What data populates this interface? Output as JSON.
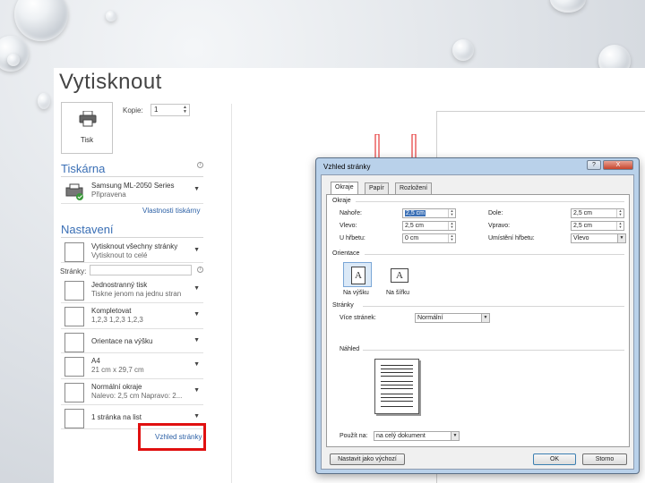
{
  "backstage": {
    "title": "Vytisknout",
    "print_button_label": "Tisk",
    "copies_label": "Kopie:",
    "copies_value": "1",
    "printer_section": "Tiskárna",
    "printer_name": "Samsung ML-2050 Series",
    "printer_status": "Připravena",
    "printer_properties_link": "Vlastnosti tiskárny",
    "settings_section": "Nastavení",
    "pages_label": "Stránky:",
    "settings": [
      {
        "line1": "Vytisknout všechny stránky",
        "line2": "Vytisknout to celé"
      },
      {
        "line1": "Jednostranný tisk",
        "line2": "Tiskne jenom na jednu stran"
      },
      {
        "line1": "Kompletovat",
        "line2": "1,2,3   1,2,3   1,2,3"
      },
      {
        "line1": "Orientace na výšku",
        "line2": ""
      },
      {
        "line1": "A4",
        "line2": "21 cm x 29,7 cm"
      },
      {
        "line1": "Normální okraje",
        "line2": "Nalevo: 2,5 cm   Napravo: 2..."
      },
      {
        "line1": "1 stránka na list",
        "line2": ""
      }
    ],
    "page_setup_link": "Vzhled stránky"
  },
  "dialog": {
    "title": "Vzhled stránky",
    "help_btn": "?",
    "close_btn": "X",
    "tabs": [
      "Okraje",
      "Papír",
      "Rozložení"
    ],
    "margins_group": "Okraje",
    "top_label": "Nahoře:",
    "top_value": "2,5 cm",
    "bottom_label": "Dole:",
    "bottom_value": "2,5 cm",
    "left_label": "Vlevo:",
    "left_value": "2,5 cm",
    "right_label": "Vpravo:",
    "right_value": "2,5 cm",
    "gutter_label": "U hřbetu:",
    "gutter_value": "0 cm",
    "gutter_pos_label": "Umístění hřbetu:",
    "gutter_pos_value": "Vlevo",
    "orientation_group": "Orientace",
    "portrait_label": "Na výšku",
    "landscape_label": "Na šířku",
    "pages_group": "Stránky",
    "multiple_pages_label": "Více stránek:",
    "multiple_pages_value": "Normální",
    "preview_group": "Náhled",
    "apply_to_label": "Použít na:",
    "apply_to_value": "na celý dokument",
    "default_button": "Nastavit jako výchozí",
    "ok_button": "OK",
    "cancel_button": "Storno"
  },
  "colors": {
    "accent": "#3a6fb5",
    "highlight": "#e01010"
  }
}
